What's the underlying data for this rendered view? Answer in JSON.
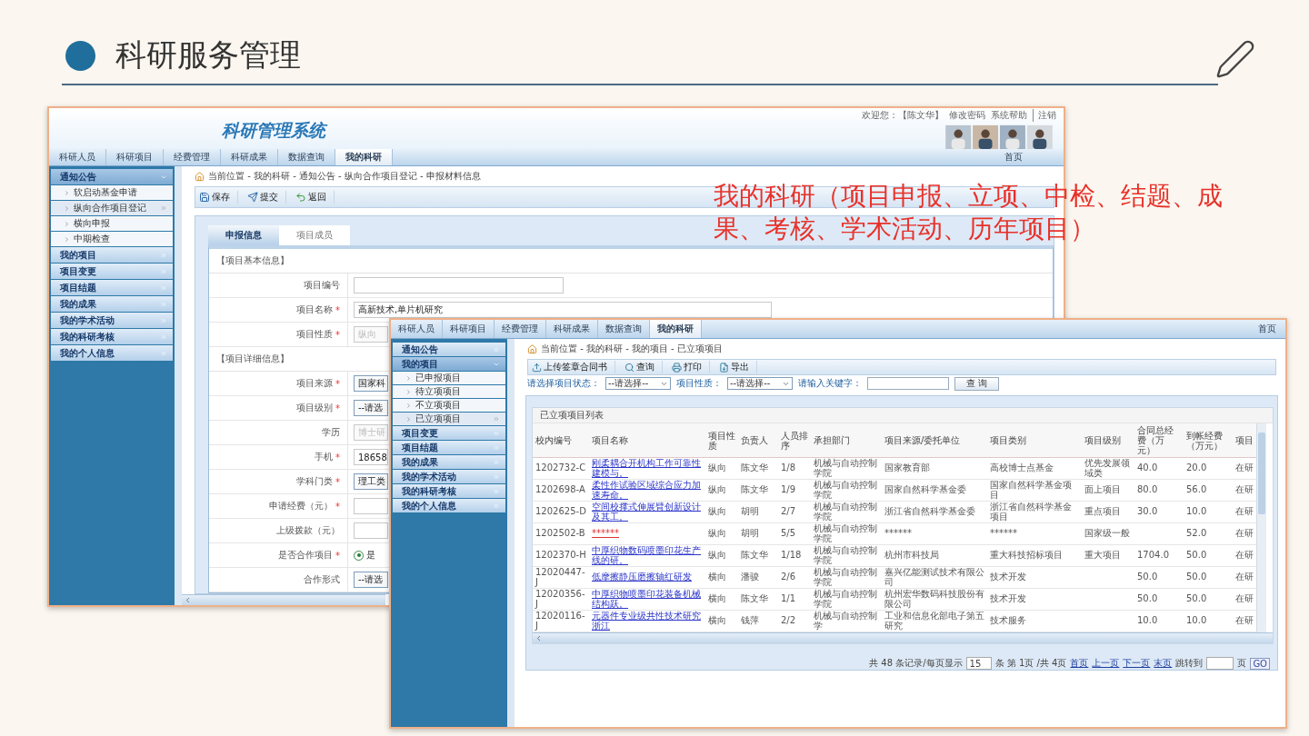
{
  "slide": {
    "title": "科研服务管理"
  },
  "annotation": "我的科研（项目申报、立项、中检、结题、成果、考核、学术活动、历年项目）",
  "window_1": {
    "app_title": "科研管理系统",
    "user_bar": {
      "greeting": "欢迎您：【陈文华】",
      "links": [
        "修改密码",
        "系统帮助",
        "注销"
      ]
    },
    "nav": {
      "tabs": [
        {
          "label": "科研人员",
          "selected": false
        },
        {
          "label": "科研项目",
          "selected": false
        },
        {
          "label": "经费管理",
          "selected": false
        },
        {
          "label": "科研成果",
          "selected": false
        },
        {
          "label": "数据查询",
          "selected": false
        },
        {
          "label": "我的科研",
          "selected": true
        }
      ],
      "home": "首页"
    },
    "sidebar": [
      {
        "label": "通知公告",
        "expanded": true,
        "children": [
          {
            "label": "软启动基金申请",
            "selected": false
          },
          {
            "label": "纵向合作项目登记",
            "selected": true
          },
          {
            "label": "横向申报",
            "selected": false
          },
          {
            "label": "中期检查",
            "selected": false
          }
        ]
      },
      {
        "label": "我的项目",
        "expanded": false
      },
      {
        "label": "项目变更",
        "expanded": false
      },
      {
        "label": "项目结题",
        "expanded": false
      },
      {
        "label": "我的成果",
        "expanded": false
      },
      {
        "label": "我的学术活动",
        "expanded": false
      },
      {
        "label": "我的科研考核",
        "expanded": false
      },
      {
        "label": "我的个人信息",
        "expanded": false
      }
    ],
    "breadcrumb": "当前位置 - 我的科研 - 通知公告 - 纵向合作项目登记 - 申报材料信息",
    "toolbar": [
      "保存",
      "提交",
      "返回"
    ],
    "tabs": [
      {
        "label": "申报信息",
        "selected": true
      },
      {
        "label": "项目成员",
        "selected": false
      }
    ],
    "sections": [
      {
        "title": "【项目基本信息】",
        "fields": [
          {
            "label": "项目编号",
            "kind": "text"
          },
          {
            "label": "项目名称",
            "mark": "*",
            "kind": "text",
            "value": "高新技术,单片机研究"
          },
          {
            "label": "项目性质",
            "mark": "*",
            "kind": "text",
            "value": "纵向",
            "disabled": true
          }
        ]
      },
      {
        "title": "【项目详细信息】",
        "fields": [
          {
            "label": "项目来源",
            "mark": "*",
            "kind": "select",
            "value": "国家科"
          },
          {
            "label": "项目级别",
            "mark": "*",
            "kind": "select",
            "value": "--请选"
          },
          {
            "label": "学历",
            "kind": "text",
            "value": "博士研",
            "disabled": true
          },
          {
            "label": "手机",
            "mark": "*",
            "kind": "text",
            "value": "18658"
          },
          {
            "label": "学科门类",
            "mark": "*",
            "kind": "select",
            "value": "理工类"
          },
          {
            "label": "申请经费（元）",
            "mark": "*",
            "kind": "text"
          },
          {
            "label": "上级拨款（元）",
            "kind": "text"
          },
          {
            "label": "是否合作项目",
            "mark": "*",
            "kind": "radio",
            "options": [
              {
                "label": "是",
                "checked": true
              }
            ]
          },
          {
            "label": "合作形式",
            "kind": "select",
            "value": "--请选"
          }
        ]
      }
    ]
  },
  "window_2": {
    "nav": {
      "tabs": [
        {
          "label": "科研人员",
          "selected": false
        },
        {
          "label": "科研项目",
          "selected": false
        },
        {
          "label": "经费管理",
          "selected": false
        },
        {
          "label": "科研成果",
          "selected": false
        },
        {
          "label": "数据查询",
          "selected": false
        },
        {
          "label": "我的科研",
          "selected": true
        }
      ],
      "home": "首页"
    },
    "sidebar": [
      {
        "label": "通知公告",
        "expanded": false
      },
      {
        "label": "我的项目",
        "expanded": true,
        "children": [
          {
            "label": "已申报项目",
            "selected": false
          },
          {
            "label": "待立项项目",
            "selected": false
          },
          {
            "label": "不立项项目",
            "selected": false
          },
          {
            "label": "已立项项目",
            "selected": true
          }
        ]
      },
      {
        "label": "项目变更",
        "expanded": false
      },
      {
        "label": "项目结题",
        "expanded": false
      },
      {
        "label": "我的成果",
        "expanded": false
      },
      {
        "label": "我的学术活动",
        "expanded": false
      },
      {
        "label": "我的科研考核",
        "expanded": false
      },
      {
        "label": "我的个人信息",
        "expanded": false
      }
    ],
    "breadcrumb": "当前位置 - 我的科研 - 我的项目 - 已立项项目",
    "toolbar": [
      "上传签章合同书",
      "查询",
      "打印",
      "导出"
    ],
    "filters": [
      {
        "label": "请选择项目状态：",
        "kind": "select",
        "value": "--请选择--"
      },
      {
        "label": "项目性质：",
        "kind": "select",
        "value": "--请选择--"
      },
      {
        "label": "请输入关键字：",
        "kind": "text"
      }
    ],
    "search_button": "查 询",
    "table": {
      "caption": "已立项项目列表",
      "columns": [
        "校内编号",
        "项目名称",
        "项目性质",
        "负责人",
        "人员排序",
        "承担部门",
        "项目来源/委托单位",
        "项目类别",
        "项目级别",
        "合同总经费（万元）",
        "到帐经费（万元）",
        "项目"
      ],
      "rows": [
        {
          "flagged": false,
          "cells": [
            "1202732-C",
            "刚柔耦合开机构工作可靠性建模与。",
            "纵向",
            "陈文华",
            "1/8",
            "机械与自动控制学院",
            "国家教育部",
            "高校博士点基金",
            "优先发展领域类",
            "40.0",
            "20.0",
            "在研"
          ]
        },
        {
          "flagged": false,
          "cells": [
            "1202698-A",
            "柔性作试验区域综合应力加速寿命。",
            "纵向",
            "陈文华",
            "1/9",
            "机械与自动控制学院",
            "国家自然科学基金委",
            "国家自然科学基金项目",
            "面上项目",
            "80.0",
            "56.0",
            "在研"
          ]
        },
        {
          "flagged": false,
          "cells": [
            "1202625-D",
            "空间校撑式伸展臂创新设计及其工。",
            "纵向",
            "胡明",
            "2/7",
            "机械与自动控制学院",
            "浙江省自然科学基金委",
            "浙江省自然科学基金项目",
            "重点项目",
            "30.0",
            "10.0",
            "在研"
          ]
        },
        {
          "flagged": true,
          "cells": [
            "1202502-B",
            "******",
            "纵向",
            "胡明",
            "5/5",
            "机械与自动控制学院",
            "******",
            "******",
            "国家级一般",
            null,
            "52.0",
            "在研"
          ]
        },
        {
          "flagged": false,
          "cells": [
            "1202370-H",
            "中厚织物数码喷墨印花生产线的研。",
            "纵向",
            "陈文华",
            "1/18",
            "机械与自动控制学院",
            "杭州市科技局",
            "重大科技招标项目",
            "重大项目",
            "1704.0",
            "50.0",
            "在研"
          ]
        },
        {
          "flagged": false,
          "cells": [
            "12020447-J",
            "低摩擦静压磨擦轴红研发",
            "横向",
            "潘骏",
            "2/6",
            "机械与自动控制学院",
            "嘉兴亿能测试技术有限公司",
            "技术开发",
            null,
            "50.0",
            "50.0",
            "在研"
          ]
        },
        {
          "flagged": false,
          "cells": [
            "12020356-J",
            "中厚织物喷墨印花装备机械结构跃。",
            "横向",
            "陈文华",
            "1/1",
            "机械与自动控制学院",
            "杭州宏华数码科技股份有限公司",
            "技术开发",
            null,
            "50.0",
            "50.0",
            "在研"
          ]
        },
        {
          "flagged": false,
          "cells": [
            "12020116-J",
            "元器件专业级共性技术研究浙江",
            "横向",
            "钱萍",
            "2/2",
            "机械与自动控制学",
            "工业和信息化部电子第五研究",
            "技术服务",
            null,
            "10.0",
            "10.0",
            "在研"
          ]
        }
      ]
    },
    "pager": {
      "summary": "共 48 条记录/每页显示",
      "page_size": "15",
      "position": "条 第 1页 /共 4页",
      "links": [
        "首页",
        "上一页",
        "下一页",
        "末页"
      ],
      "jump_label": "跳转到",
      "page_unit": "页",
      "go": "GO"
    }
  }
}
